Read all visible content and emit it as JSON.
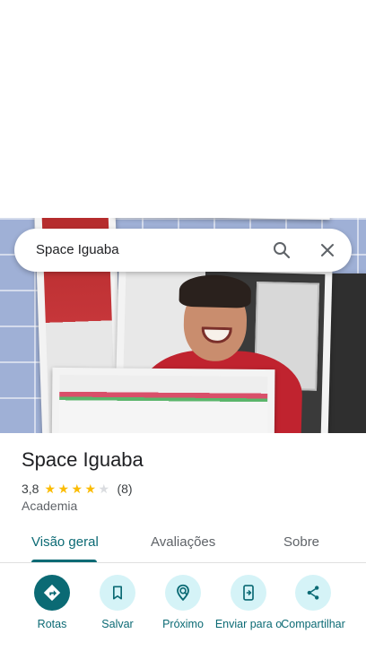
{
  "search": {
    "query": "Space Iguaba",
    "search_icon": "search-icon",
    "close_icon": "close-icon"
  },
  "place": {
    "title": "Space Iguaba",
    "rating": "3,8",
    "rating_value": 3.8,
    "stars_max": 5,
    "review_count": "(8)",
    "category": "Academia"
  },
  "tabs": [
    {
      "label": "Visão geral",
      "active": true
    },
    {
      "label": "Avaliações",
      "active": false
    },
    {
      "label": "Sobre",
      "active": false
    }
  ],
  "actions": [
    {
      "label": "Rotas",
      "icon": "directions-icon"
    },
    {
      "label": "Salvar",
      "icon": "bookmark-icon"
    },
    {
      "label": "Próximo",
      "icon": "nearby-icon"
    },
    {
      "label": "Enviar para o",
      "icon": "send-to-phone-icon"
    },
    {
      "label": "Compartilhar",
      "icon": "share-icon"
    }
  ],
  "colors": {
    "accent": "#0b6a74",
    "accent_light": "#d5f3f7",
    "star": "#fbbc04"
  }
}
